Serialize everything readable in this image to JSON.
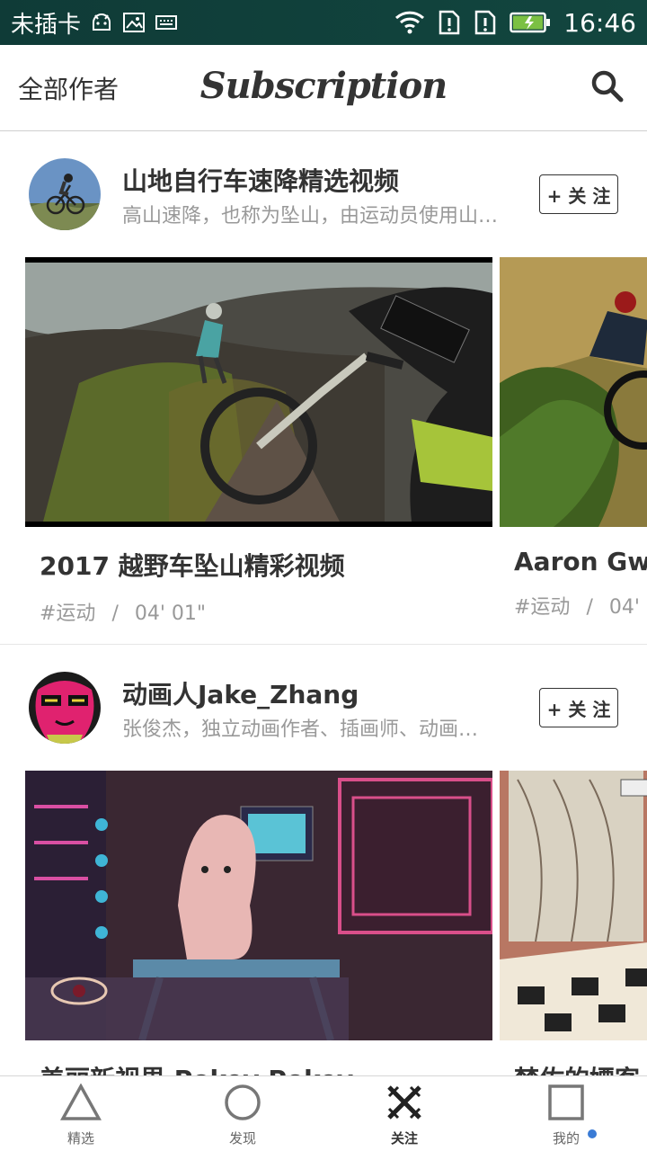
{
  "status_bar": {
    "carrier": "未插卡",
    "time": "16:46"
  },
  "header": {
    "left_label": "全部作者",
    "title": "Subscription"
  },
  "sections": [
    {
      "author_name": "山地自行车速降精选视频",
      "author_desc": "高山速降，也称为坠山，由运动员使用山地自行车…",
      "follow_label": "+ 关 注",
      "videos": [
        {
          "title": "2017 越野车坠山精彩视频",
          "tag": "#运动",
          "sep": "/",
          "duration": "04' 01\""
        },
        {
          "title": "Aaron Gw",
          "tag": "#运动",
          "sep": "/",
          "duration": "04'"
        }
      ]
    },
    {
      "author_name": "动画人Jake_Zhang",
      "author_desc": "张俊杰，独立动画作者、插画师、动画…",
      "follow_label": "+ 关 注",
      "videos": [
        {
          "title": "美丽新视界 Pokey Pokey",
          "tag": "",
          "sep": "",
          "duration": ""
        },
        {
          "title": "梵佐的嫖客",
          "tag": "",
          "sep": "",
          "duration": ""
        }
      ]
    }
  ],
  "tabs": [
    {
      "label": "精选",
      "icon": "triangle-icon"
    },
    {
      "label": "发现",
      "icon": "circle-icon"
    },
    {
      "label": "关注",
      "icon": "crossed-x-icon"
    },
    {
      "label": "我的",
      "icon": "square-icon"
    }
  ],
  "active_tab": "关注",
  "colors": {
    "status_bar_bg": "#12463f",
    "battery_fill": "#7bc043",
    "notification_dot": "#3a7bd5"
  }
}
